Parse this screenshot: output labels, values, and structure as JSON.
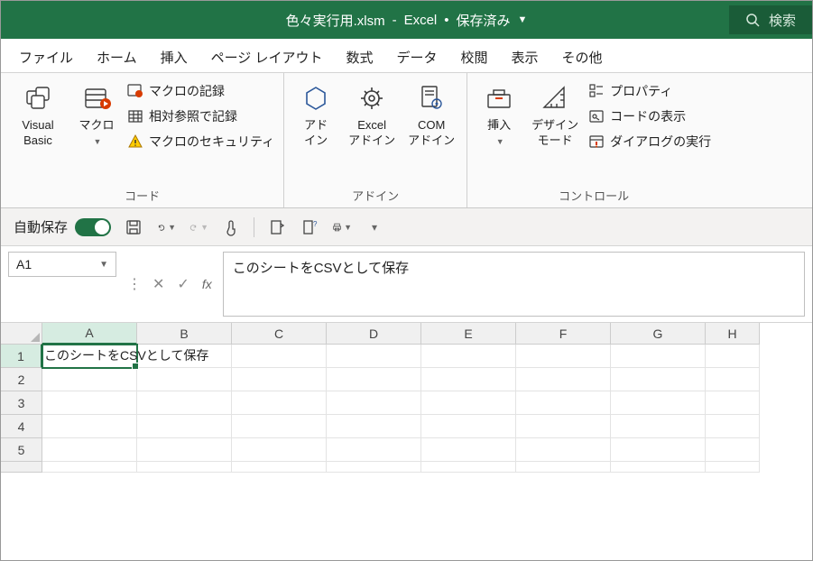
{
  "title": {
    "filename": "色々実行用.xlsm",
    "app": "Excel",
    "status": "保存済み"
  },
  "search": {
    "placeholder": "検索"
  },
  "tabs": [
    "ファイル",
    "ホーム",
    "挿入",
    "ページ レイアウト",
    "数式",
    "データ",
    "校閲",
    "表示",
    "その他"
  ],
  "ribbon": {
    "code": {
      "vb": "Visual Basic",
      "macro": "マクロ",
      "record": "マクロの記録",
      "relative": "相対参照で記録",
      "security": "マクロのセキュリティ",
      "group": "コード"
    },
    "addins": {
      "addin": "アド\nイン",
      "excel": "Excel\nアドイン",
      "com": "COM\nアドイン",
      "group": "アドイン"
    },
    "controls": {
      "insert": "挿入",
      "design": "デザイン\nモード",
      "props": "プロパティ",
      "viewcode": "コードの表示",
      "dialog": "ダイアログの実行",
      "group": "コントロール"
    }
  },
  "qat": {
    "autosave": "自動保存",
    "on": "オン"
  },
  "namebox": "A1",
  "formula": "このシートをCSVとして保存",
  "columns": [
    "A",
    "B",
    "C",
    "D",
    "E",
    "F",
    "G",
    "H"
  ],
  "rows": [
    "1",
    "2",
    "3",
    "4",
    "5"
  ],
  "cellA1": "このシートをCSVとして保存"
}
